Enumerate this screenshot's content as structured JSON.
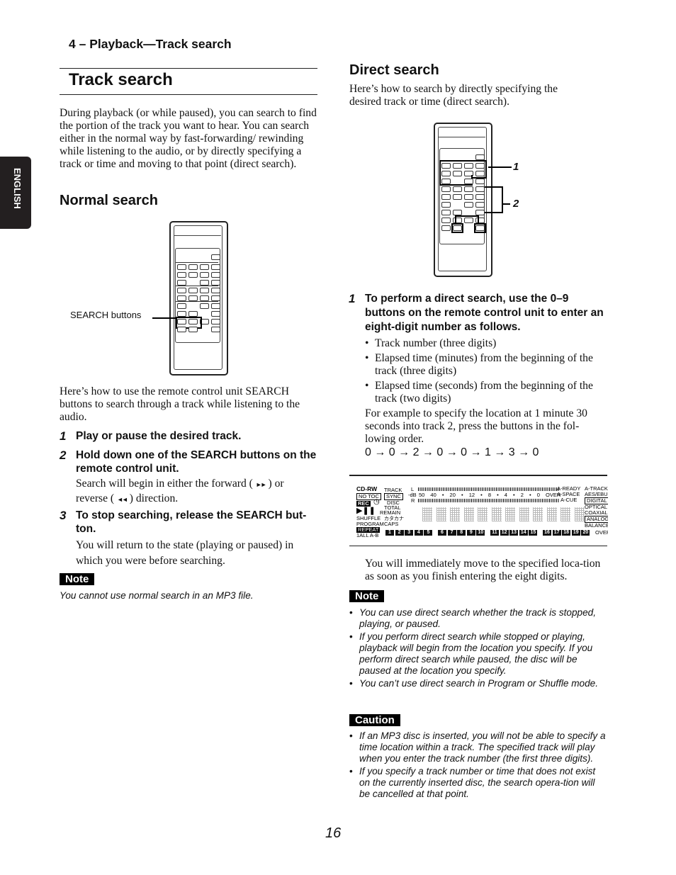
{
  "side_tab": {
    "label": "ENGLISH"
  },
  "running_head": "4 – Playback—Track search",
  "title": "Track search",
  "intro": "During playback (or while paused), you can search to find the portion of the track you want to hear. You can search either in the normal way by fast-forwarding/ rewinding while listening to the audio, or by directly specifying a track or time and moving to that point (direct search).",
  "normal_search": {
    "heading": "Normal search",
    "figure_callout": "SEARCH buttons",
    "description": "Here’s how to use the remote control unit SEARCH buttons to search through a track while listening to the audio.",
    "steps": [
      {
        "num": "1",
        "title": "Play or pause the desired track.",
        "body": ""
      },
      {
        "num": "2",
        "title": "Hold down one of the SEARCH buttons on the remote control unit.",
        "body_pre": "Search will begin in either the forward (",
        "forward_icon": "►►",
        "body_mid": ") or reverse (",
        "reverse_icon": "◄◄",
        "body_post": ") direction."
      },
      {
        "num": "3",
        "title": "To stop searching, release the SEARCH but-ton.",
        "body": "You will return to the state (playing or paused) in which you were before searching."
      }
    ],
    "note_label": "Note",
    "note_text": "You cannot use normal search in an MP3 file."
  },
  "direct_search": {
    "heading": "Direct search",
    "description": "Here’s how to search by directly specifying the desired track or time (direct search).",
    "figure_callouts": [
      "1",
      "2"
    ],
    "step": {
      "num": "1",
      "title": "To perform a direct search, use the 0–9 buttons on the remote control unit to enter an eight-digit number as follows.",
      "bullets": [
        "Track number (three digits)",
        "Elapsed time (minutes) from the beginning of the track (three digits)",
        "Elapsed time (seconds) from the beginning of the track (two digits)"
      ],
      "example": "For example to specify the location at 1 minute 30 seconds into track 2, press the buttons in the fol-lowing order.",
      "sequence": "0 → 0 → 2 → 0 → 0 → 1 → 3 → 0"
    },
    "display": {
      "left_labels": {
        "cdrw": "CD-RW",
        "notoc": "NO TOC",
        "rec": "REC",
        "shuffle": "SHUFFLE",
        "program": "PROGRAM",
        "repeat": "REPEAT",
        "repeat_modes": "1ALL A-B"
      },
      "mid_labels": {
        "track": "TRACK",
        "sync": "SYNC",
        "disc": "DISC",
        "total": "TOTAL",
        "remain": "REMAIN",
        "katakana": "カタカナ",
        "caps": "CAPS"
      },
      "meter": {
        "l": "L",
        "r": "R",
        "db": "-dB",
        "scale": [
          "50",
          "40",
          "•",
          "20",
          "•",
          "12",
          "•",
          "8",
          "•",
          "4",
          "•",
          "2",
          "•",
          "0",
          "OVER"
        ]
      },
      "right_labels": [
        "A-READY",
        "A-SPACE",
        "A-CUE"
      ],
      "far_right_labels": [
        "A-TRACK",
        "AES/EBU",
        "DIGITAL",
        "OPTICAL",
        "COAXIAL",
        "ANALOG",
        "BALANCE"
      ],
      "track_numbers": [
        "1",
        "2",
        "3",
        "4",
        "5",
        "6",
        "7",
        "8",
        "9",
        "10",
        "11",
        "12",
        "13",
        "14",
        "15",
        "16",
        "17",
        "18",
        "19",
        "20"
      ],
      "over_label": "OVER"
    },
    "after_text": "You will immediately move to the specified loca-tion as soon as you finish entering the eight digits.",
    "note_label": "Note",
    "notes": [
      "You can use direct search whether the track is stopped, playing, or paused.",
      "If you perform direct search while stopped or playing, playback will begin from the location you specify. If you perform direct search while paused, the disc will be paused at the location you specify.",
      "You can’t use direct search in Program or Shuffle mode."
    ],
    "caution_label": "Caution",
    "cautions": [
      "If an MP3 disc is inserted, you will not be able to specify a time location within a track. The specified track will play when you enter the track number (the first three digits).",
      "If you specify a track number or time that does not exist on the currently inserted disc, the search opera-tion will be cancelled at that point."
    ]
  },
  "page_number": "16"
}
